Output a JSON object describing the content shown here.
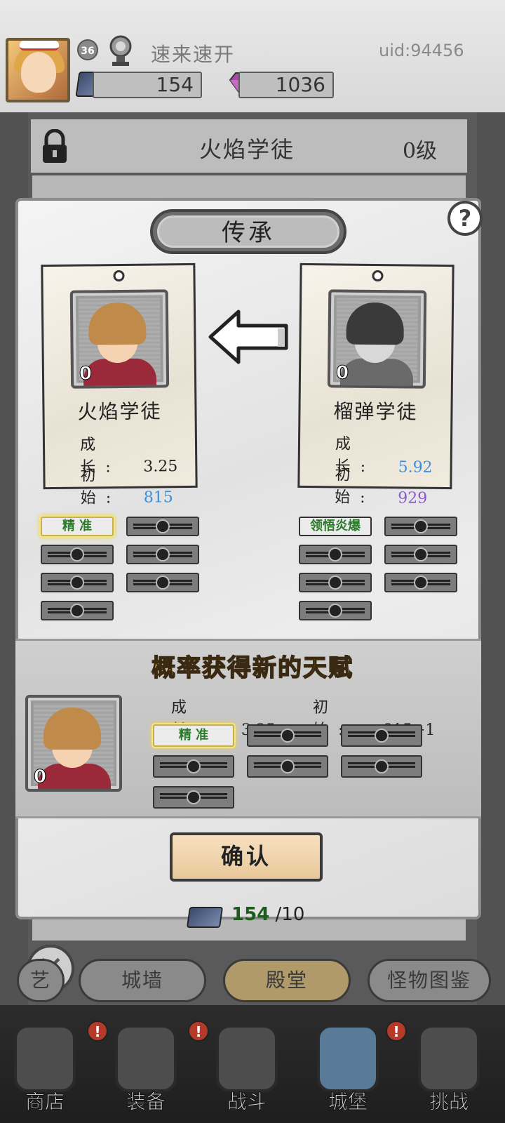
{
  "header": {
    "player_level": "36",
    "player_name": "速来速开",
    "uid": "uid:94456",
    "books": "154",
    "gems": "1036"
  },
  "class_header": {
    "title": "火焰学徒",
    "level": "0级"
  },
  "modal": {
    "title": "传承",
    "help": "?",
    "left_card": {
      "level": "0",
      "name": "火焰学徒",
      "growth_label": "成 长:",
      "growth_value": "3.25",
      "initial_label": "初 始:",
      "initial_value": "815",
      "skills": [
        "精  准"
      ]
    },
    "right_card": {
      "level": "0",
      "name": "榴弹学徒",
      "growth_label": "成 长:",
      "growth_value": "5.92",
      "initial_label": "初 始:",
      "initial_value": "929",
      "skills": [
        "领悟炎爆"
      ]
    },
    "result": {
      "title": "概率获得新的天赋",
      "level": "0",
      "growth_label": "成 长:",
      "growth_value": "3.25",
      "initial_label": "初 始:",
      "initial_value": "815+1",
      "skills": [
        "精  准"
      ]
    },
    "confirm": "确认"
  },
  "book_counter": {
    "have": "154",
    "need": "/10"
  },
  "tabs": [
    {
      "label": "艺"
    },
    {
      "label": "城墙"
    },
    {
      "label": "殿堂"
    },
    {
      "label": "怪物图鉴"
    }
  ],
  "nav": [
    {
      "label": "商店",
      "badge": "!"
    },
    {
      "label": "装备",
      "badge": "!"
    },
    {
      "label": "战斗",
      "badge": ""
    },
    {
      "label": "城堡",
      "badge": "!"
    },
    {
      "label": "挑战",
      "badge": ""
    }
  ],
  "colors": {
    "growth_high": "#3a8ee0",
    "initial_high": "#8a5ad0",
    "initial_low": "#3a8ee0",
    "skill_green": "#2a7a2a",
    "gold_title": "#d9ab4a"
  }
}
